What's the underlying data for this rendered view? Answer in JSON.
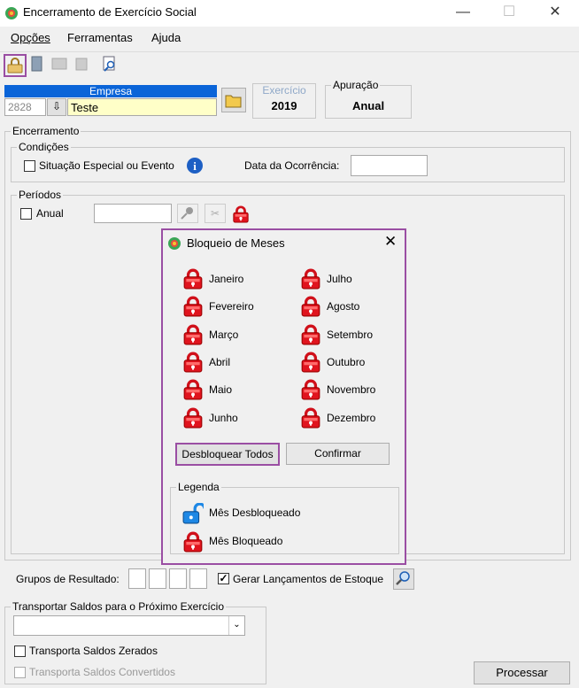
{
  "window": {
    "title": "Encerramento de Exercício Social"
  },
  "menu": [
    "Opções",
    "Ferramentas",
    "Ajuda"
  ],
  "empresa": {
    "header": "Empresa",
    "code": "2828",
    "name": "Teste"
  },
  "exercicio": {
    "label": "Exercício",
    "value": "2019"
  },
  "apuracao": {
    "label": "Apuração",
    "value": "Anual"
  },
  "encerramento": {
    "label": "Encerramento",
    "condicoes_label": "Condições",
    "situacao_especial": "Situação Especial ou Evento",
    "data_ocorrencia_label": "Data da Ocorrência:",
    "periodos_label": "Períodos",
    "anual_label": "Anual"
  },
  "dialog": {
    "title": "Bloqueio de Meses",
    "months_left": [
      "Janeiro",
      "Fevereiro",
      "Março",
      "Abril",
      "Maio",
      "Junho"
    ],
    "months_right": [
      "Julho",
      "Agosto",
      "Setembro",
      "Outubro",
      "Novembro",
      "Dezembro"
    ],
    "unlock_all": "Desbloquear Todos",
    "confirm": "Confirmar",
    "legend_label": "Legenda",
    "legend_unlocked": "Mês Desbloqueado",
    "legend_locked": "Mês Bloqueado"
  },
  "grupos": {
    "label": "Grupos de Resultado:",
    "gerar": "Gerar Lançamentos de Estoque",
    "gerar_checked": true
  },
  "transportar": {
    "label": "Transportar Saldos para o Próximo Exercício",
    "zerados": "Transporta Saldos Zerados",
    "convertidos": "Transporta Saldos Convertidos"
  },
  "processar": "Processar",
  "colors": {
    "accent": "#0a64d8",
    "highlight": "#9a4ea3",
    "lock": "#e0141e"
  }
}
